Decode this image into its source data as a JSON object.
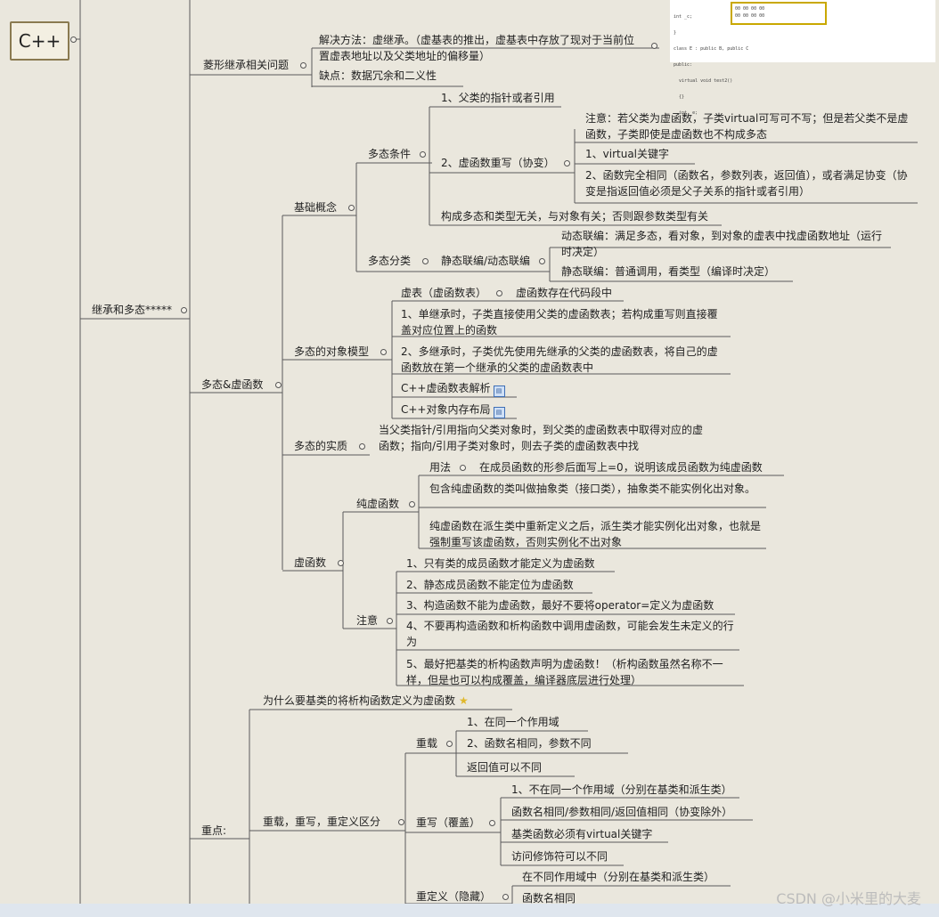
{
  "root": {
    "label": "C++"
  },
  "thumbnail": {
    "code_lines": [
      "int _c;",
      "}",
      "class E : public B, public C",
      "public:",
      "  virtual void test2()",
      "  {}",
      "  int _e;"
    ],
    "memory_rows": [
      "00 00 00 00",
      "00 00 00 00"
    ]
  },
  "diamond": {
    "title": "菱形继承相关问题",
    "solution": "解决方法：虚继承。（虚基表的推出，虚基表中存放了现对于当前位置虚表地址以及父类地址的偏移量）",
    "drawback": "缺点：数据冗余和二义性"
  },
  "inherit": {
    "title": "继承和多态*****"
  },
  "poly": {
    "title": "多态&虚函数",
    "basic": {
      "title": "基础概念",
      "conditions": {
        "title": "多态条件",
        "c1": "1、父类的指针或者引用",
        "c2": "2、虚函数重写（协变）",
        "note": "注意：若父类为虚函数，子类virtual可写可不写；但是若父类不是虚函数，子类即使是虚函数也不构成多态",
        "kw": "1、virtual关键字",
        "same": "2、函数完全相同（函数名，参数列表，返回值），或者满足协变（协变是指返回值必须是父子关系的指针或者引用）",
        "type": "构成多态和类型无关，与对象有关；否则跟参数类型有关"
      },
      "classify": {
        "title": "多态分类",
        "sub": "静态联编/动态联编",
        "dynamic": "动态联编：满足多态，看对象，到对象的虚表中找虚函数地址（运行时决定）",
        "static": "静态联编：普通调用，看类型（编译时决定）"
      }
    },
    "model": {
      "title": "多态的对象模型",
      "vtable": "虚表（虚函数表）",
      "vtable_where": "虚函数存在代码段中",
      "single": "1、单继承时，子类直接使用父类的虚函数表；若构成重写则直接覆盖对应位置上的函数",
      "multi": "2、多继承时，子类优先使用先继承的父类的虚函数表，将自己的虚函数放在第一个继承的父类的虚函数表中",
      "link1": "C++虚函数表解析",
      "link2": "C++对象内存布局"
    },
    "essence": {
      "title": "多态的实质",
      "text": "当父类指针/引用指向父类对象时，到父类的虚函数表中取得对应的虚函数；指向/引用子类对象时，则去子类的虚函数表中找"
    },
    "virtual": {
      "title": "虚函数",
      "pure": {
        "title": "纯虚函数",
        "usage": "用法",
        "usage_text": "在成员函数的形参后面写上=0，说明该成员函数为纯虚函数",
        "abstract": "包含纯虚函数的类叫做抽象类（接口类），抽象类不能实例化出对象。",
        "override": "纯虚函数在派生类中重新定义之后，派生类才能实例化出对象，也就是强制重写该虚函数，否则实例化不出对象"
      },
      "notes": {
        "title": "注意",
        "n1": "1、只有类的成员函数才能定义为虚函数",
        "n2": "2、静态成员函数不能定位为虚函数",
        "n3": "3、构造函数不能为虚函数，最好不要将operator=定义为虚函数",
        "n4": "4、不要再构造函数和析构函数中调用虚函数，可能会发生未定义的行为",
        "n5": "5、最好把基类的析构函数声明为虚函数！（析构函数虽然名称不一样，但是也可以构成覆盖，编译器底层进行处理）"
      }
    }
  },
  "key": {
    "title": "重点:",
    "why": "为什么要基类的将析构函数定义为虚函数",
    "compare": {
      "title": "重载，重写，重定义区分",
      "overload": {
        "title": "重载",
        "a": "1、在同一个作用域",
        "b": "2、函数名相同，参数不同",
        "c": "返回值可以不同"
      },
      "override": {
        "title": "重写（覆盖）",
        "a": "1、不在同一个作用域（分别在基类和派生类）",
        "b": "函数名相同/参数相同/返回值相同（协变除外）",
        "c": "基类函数必须有virtual关键字",
        "d": "访问修饰符可以不同"
      },
      "redefine": {
        "title": "重定义（隐藏）",
        "a": "在不同作用域中（分别在基类和派生类）",
        "b": "函数名相同"
      }
    }
  },
  "watermark": "CSDN @小米里的大麦"
}
